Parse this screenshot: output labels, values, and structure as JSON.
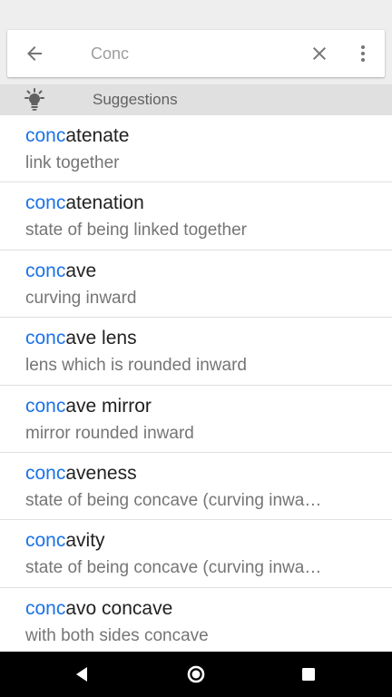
{
  "search": {
    "value": "Conc",
    "back_icon": "arrow-back-icon",
    "clear_icon": "close-icon",
    "more_icon": "more-vert-icon"
  },
  "suggestions_header": {
    "icon": "lightbulb-icon",
    "label": "Suggestions"
  },
  "items": [
    {
      "highlight": "conc",
      "rest": "atenate",
      "definition": "link together"
    },
    {
      "highlight": "conc",
      "rest": "atenation",
      "definition": "state of being linked together"
    },
    {
      "highlight": "conc",
      "rest": "ave",
      "definition": "curving inward"
    },
    {
      "highlight": "conc",
      "rest": "ave lens",
      "definition": "lens which is rounded inward"
    },
    {
      "highlight": "conc",
      "rest": "ave mirror",
      "definition": "mirror rounded inward"
    },
    {
      "highlight": "conc",
      "rest": "aveness",
      "definition": "state of being concave (curving inwa…"
    },
    {
      "highlight": "conc",
      "rest": "avity",
      "definition": "state of being concave (curving inwa…"
    },
    {
      "highlight": "conc",
      "rest": "avo concave",
      "definition": "with both sides concave"
    }
  ],
  "colors": {
    "highlight": "#1a73e8",
    "header_bg": "#e0e0e0",
    "navbar_bg": "#000000"
  },
  "navbar": {
    "back_icon": "nav-back-icon",
    "home_icon": "nav-home-icon",
    "recents_icon": "nav-recents-icon"
  }
}
